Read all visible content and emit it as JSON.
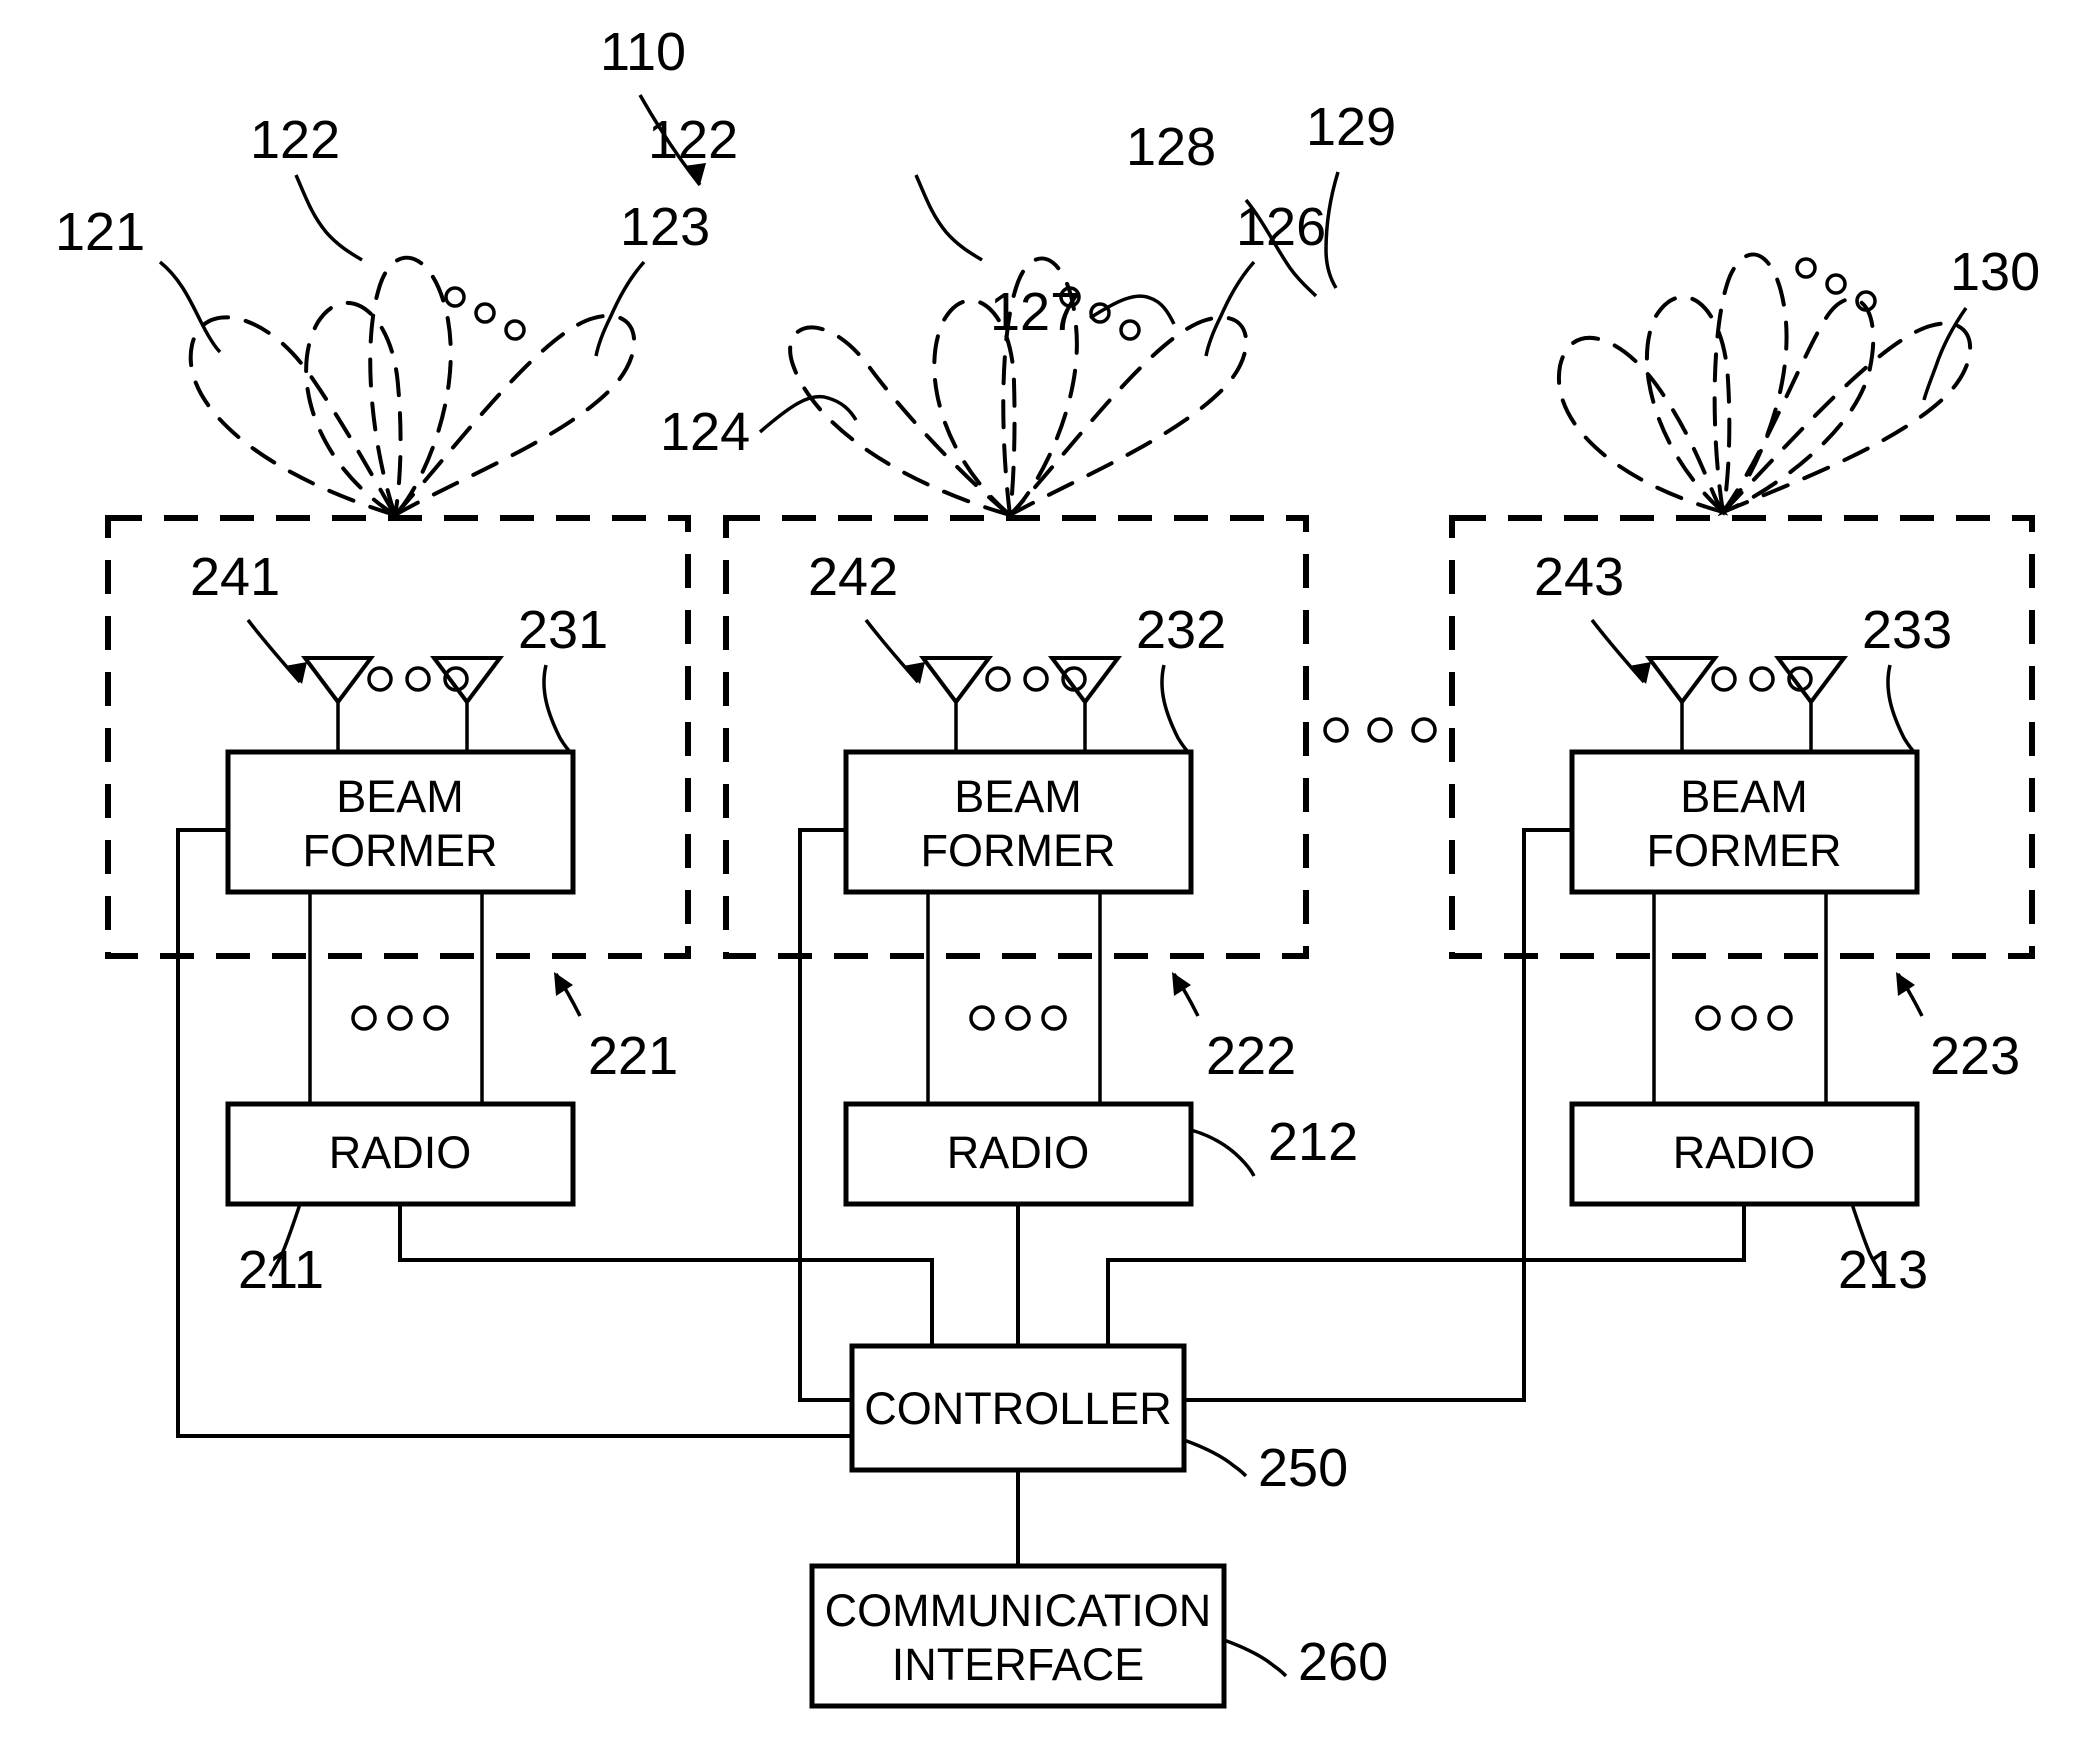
{
  "figure": {
    "title_ref": "110",
    "type": "patent-block-diagram"
  },
  "beam_labels": {
    "g1_left": "121",
    "g1_mid": "122",
    "g1_right": "123",
    "g2_panel": "124",
    "g2_mid": "122",
    "g2_right": "126",
    "g3_left": "127",
    "g3_mid1": "128",
    "g3_mid2": "129",
    "g3_right": "130"
  },
  "panels": [
    {
      "panel_ref": "241",
      "antenna_ref": "231",
      "beamformer_label_line1": "BEAM",
      "beamformer_label_line2": "FORMER",
      "radio_label": "RADIO",
      "radio_ref": "211",
      "group_ref": "221"
    },
    {
      "panel_ref": "242",
      "antenna_ref": "232",
      "beamformer_label_line1": "BEAM",
      "beamformer_label_line2": "FORMER",
      "radio_label": "RADIO",
      "radio_ref": "212",
      "group_ref": "222"
    },
    {
      "panel_ref": "243",
      "antenna_ref": "233",
      "beamformer_label_line1": "BEAM",
      "beamformer_label_line2": "FORMER",
      "radio_label": "RADIO",
      "radio_ref": "213",
      "group_ref": "223"
    }
  ],
  "controller": {
    "label": "CONTROLLER",
    "ref": "250"
  },
  "comm_interface": {
    "label_line1": "COMMUNICATION",
    "label_line2": "INTERFACE",
    "ref": "260"
  },
  "colors": {
    "ink": "#000000",
    "paper": "#ffffff"
  }
}
